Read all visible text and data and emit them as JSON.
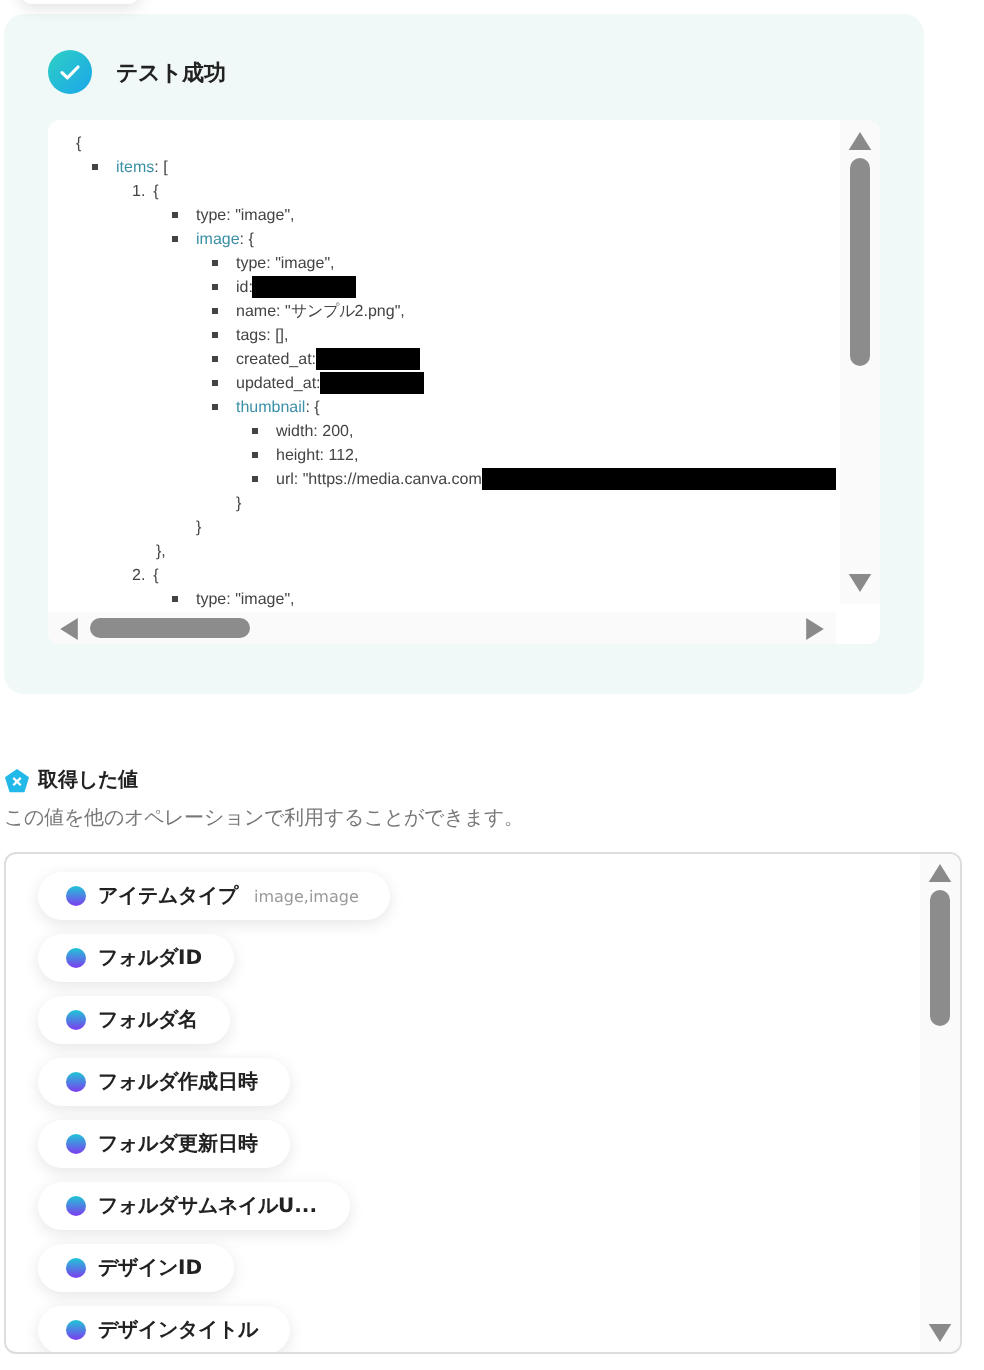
{
  "test_result": {
    "title": "テスト成功",
    "code": [
      {
        "kind": "plain",
        "text": "{",
        "children": [
          {
            "kind": "bullet",
            "key": "items",
            "text": ": [",
            "children": [
              {
                "kind": "numbered",
                "number": "1.",
                "text": "{",
                "children": [
                  {
                    "kind": "bullet",
                    "text": "type: \"image\","
                  },
                  {
                    "kind": "bullet",
                    "key": "image",
                    "text": ": {",
                    "children": [
                      {
                        "kind": "bullet",
                        "text": "type: \"image\","
                      },
                      {
                        "kind": "bullet",
                        "text": "id:",
                        "redacted": true
                      },
                      {
                        "kind": "bullet",
                        "text": "name: \"サンプル2.png\","
                      },
                      {
                        "kind": "bullet",
                        "text": "tags: [],"
                      },
                      {
                        "kind": "bullet",
                        "text": "created_at:",
                        "redacted": true
                      },
                      {
                        "kind": "bullet",
                        "text": "updated_at:",
                        "redacted": true
                      },
                      {
                        "kind": "bullet",
                        "key": "thumbnail",
                        "text": ": {",
                        "children": [
                          {
                            "kind": "bullet",
                            "text": "width: 200,"
                          },
                          {
                            "kind": "bullet",
                            "text": "height: 112,"
                          },
                          {
                            "kind": "bullet",
                            "text": "url: \"https://media.canva.com",
                            "redacted": true,
                            "redaction_to_edge": true
                          }
                        ]
                      },
                      {
                        "kind": "plain",
                        "text": "}"
                      }
                    ]
                  },
                  {
                    "kind": "plain",
                    "text": "}"
                  }
                ]
              },
              {
                "kind": "plain",
                "text": "},"
              },
              {
                "kind": "numbered",
                "number": "2.",
                "text": "{",
                "children": [
                  {
                    "kind": "bullet",
                    "text": "type: \"image\","
                  }
                ]
              }
            ]
          }
        ]
      }
    ]
  },
  "values": {
    "title": "取得した値",
    "description": "この値を他のオペレーションで利用することができます。",
    "items": [
      {
        "label": "アイテムタイプ",
        "value": "image,image"
      },
      {
        "label": "フォルダID"
      },
      {
        "label": "フォルダ名"
      },
      {
        "label": "フォルダ作成日時"
      },
      {
        "label": "フォルダ更新日時"
      },
      {
        "label": "フォルダサムネイルU..."
      },
      {
        "label": "デザインID"
      },
      {
        "label": "デザインタイトル"
      }
    ]
  }
}
